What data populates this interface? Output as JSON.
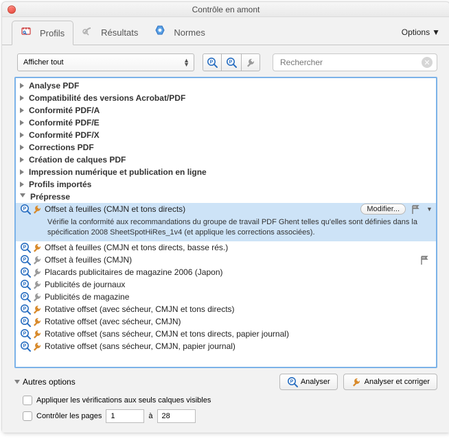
{
  "window": {
    "title": "Contrôle en amont"
  },
  "tabs": {
    "profils": "Profils",
    "resultats": "Résultats",
    "normes": "Normes",
    "options": "Options"
  },
  "toolbar": {
    "filter": "Afficher tout",
    "search_placeholder": "Rechercher"
  },
  "categories": [
    "Analyse PDF",
    "Compatibilité des versions Acrobat/PDF",
    "Conformité PDF/A",
    "Conformité PDF/E",
    "Conformité PDF/X",
    "Corrections PDF",
    "Création de calques PDF",
    "Impression numérique et publication en ligne",
    "Profils importés",
    "Prépresse"
  ],
  "selected": {
    "label": "Offset à feuilles (CMJN et tons directs)",
    "modify": "Modifier...",
    "description": "Vérifie la conformité aux recommandations du groupe de travail PDF Ghent telles qu'elles sont définies dans la spécification 2008 SheetSpotHiRes_1v4 (et applique les corrections associées)."
  },
  "profiles": [
    "Offset à feuilles (CMJN et tons directs, basse rés.)",
    "Offset à feuilles (CMJN)",
    "Placards publicitaires de magazine 2006 (Japon)",
    "Publicités de journaux",
    "Publicités de magazine",
    "Rotative offset (avec sécheur, CMJN et tons directs)",
    "Rotative offset (avec sécheur, CMJN)",
    "Rotative offset (sans sécheur, CMJN et tons directs, papier journal)",
    "Rotative offset (sans sécheur, CMJN, papier journal)"
  ],
  "footer": {
    "other_options": "Autres options",
    "analyser": "Analyser",
    "analyser_corriger": "Analyser et corriger",
    "apply_layers": "Appliquer les vérifications aux seuls calques visibles",
    "control_pages": "Contrôler les pages",
    "page_from": "1",
    "page_sep": "à",
    "page_to": "28"
  }
}
